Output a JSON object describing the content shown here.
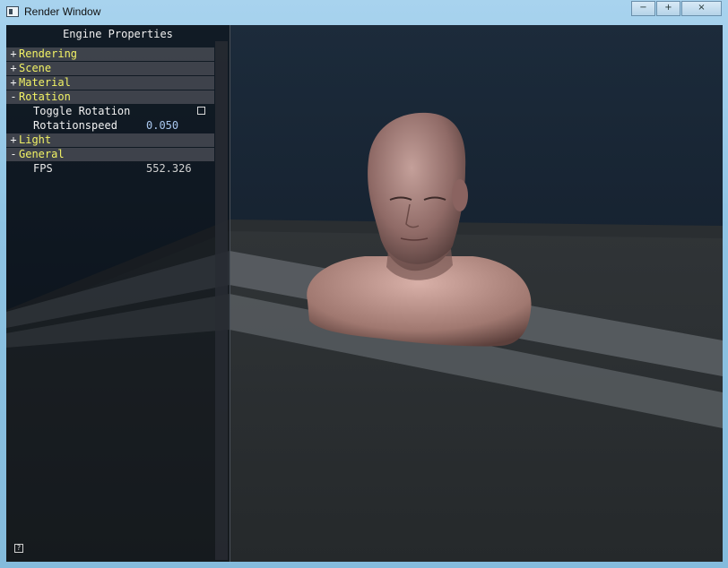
{
  "window": {
    "title": "Render Window",
    "minimize_glyph": "−",
    "maximize_glyph": "+",
    "close_glyph": "×"
  },
  "panel": {
    "title": "Engine Properties",
    "groups": [
      {
        "toggle": "+",
        "label": "Rendering"
      },
      {
        "toggle": "+",
        "label": "Scene"
      },
      {
        "toggle": "+",
        "label": "Material"
      },
      {
        "toggle": "-",
        "label": "Rotation"
      },
      {
        "toggle": "+",
        "label": "Light"
      },
      {
        "toggle": "-",
        "label": "General"
      }
    ],
    "rotation": {
      "toggle_rotation_label": "Toggle Rotation",
      "toggle_rotation_checked": false,
      "rotation_speed_label": "Rotationspeed",
      "rotation_speed_value": "0.050"
    },
    "general": {
      "fps_label": "FPS",
      "fps_value": "552.326"
    },
    "help_glyph": "?"
  },
  "colors": {
    "group_label": "#f2f265",
    "value_text": "#aac8f0",
    "panel_bg": "#0a0e14",
    "group_bg": "#464a52"
  }
}
